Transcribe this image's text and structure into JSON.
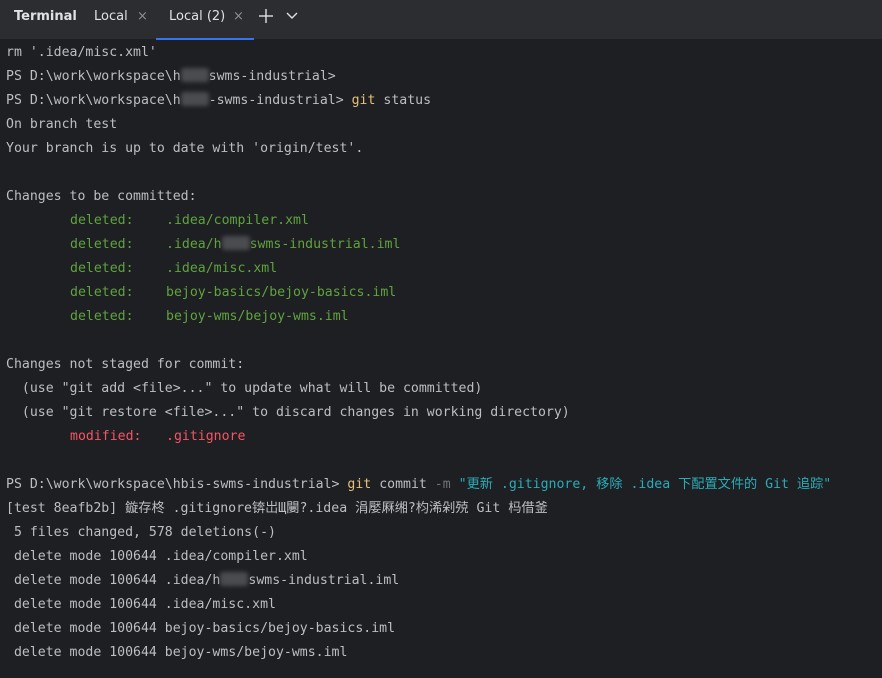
{
  "panel_title": "Terminal",
  "tabs": [
    {
      "label": "Local",
      "close_glyph": "×",
      "active": false
    },
    {
      "label": "Local (2)",
      "close_glyph": "×",
      "active": true
    }
  ],
  "toolbar": {
    "add_icon": "plus-icon",
    "dropdown_icon": "chevron-down-icon"
  },
  "console": {
    "rm_line": "rm '.idea/misc.xml'",
    "prompt_prefix": "PS D:\\work\\workspace\\h",
    "prompt_suffix": "swms-industrial>",
    "prompt_suffix2": "-swms-industrial>",
    "git_cmd": "git",
    "status_arg": " status",
    "on_branch": "On branch test",
    "up_to_date": "Your branch is up to date with 'origin/test'.",
    "to_be_committed": "Changes to be committed:",
    "deleted_entries": [
      {
        "status": "deleted:",
        "path": ".idea/compiler.xml"
      },
      {
        "status": "deleted:",
        "path_pre": ".idea/h",
        "path_post": "swms-industrial.iml"
      },
      {
        "status": "deleted:",
        "path": ".idea/misc.xml"
      },
      {
        "status": "deleted:",
        "path": "bejoy-basics/bejoy-basics.iml"
      },
      {
        "status": "deleted:",
        "path": "bejoy-wms/bejoy-wms.iml"
      }
    ],
    "not_staged": "Changes not staged for commit:",
    "hint_add": "  (use \"git add <file>...\" to update what will be committed)",
    "hint_restore": "  (use \"git restore <file>...\" to discard changes in working directory)",
    "modified_status": "modified:",
    "modified_path": ".gitignore",
    "full_prompt": "PS D:\\work\\workspace\\hbis-swms-industrial>",
    "commit_arg": " commit",
    "flag_m": "-m",
    "commit_message": "\"更新 .gitignore, 移除 .idea 下配置文件的 Git 追踪\"",
    "commit_result": "[test 8eafb2b] 鏇存柊 .gitignore锛岀Щ闄?.idea 涓嬮厤缃?枃浠剁殑 Git 杩借釜",
    "files_changed": " 5 files changed, 578 deletions(-)",
    "delete_modes": [
      {
        "text": " delete mode 100644 .idea/compiler.xml"
      },
      {
        "pre": " delete mode 100644 .idea/h",
        "post": "swms-industrial.iml"
      },
      {
        "text": " delete mode 100644 .idea/misc.xml"
      },
      {
        "text": " delete mode 100644 bejoy-basics/bejoy-basics.iml"
      },
      {
        "text": " delete mode 100644 bejoy-wms/bejoy-wms.iml"
      }
    ]
  },
  "colors": {
    "background": "#1e1f22",
    "tabbar": "#2b2d30",
    "text": "#bcbec4",
    "git_keyword": "#e5c07b",
    "deleted_green": "#5fa33f",
    "modified_red": "#f75464",
    "string_teal": "#2aacb8",
    "flag_gray": "#6f737a",
    "active_tab_underline": "#3574f0"
  }
}
